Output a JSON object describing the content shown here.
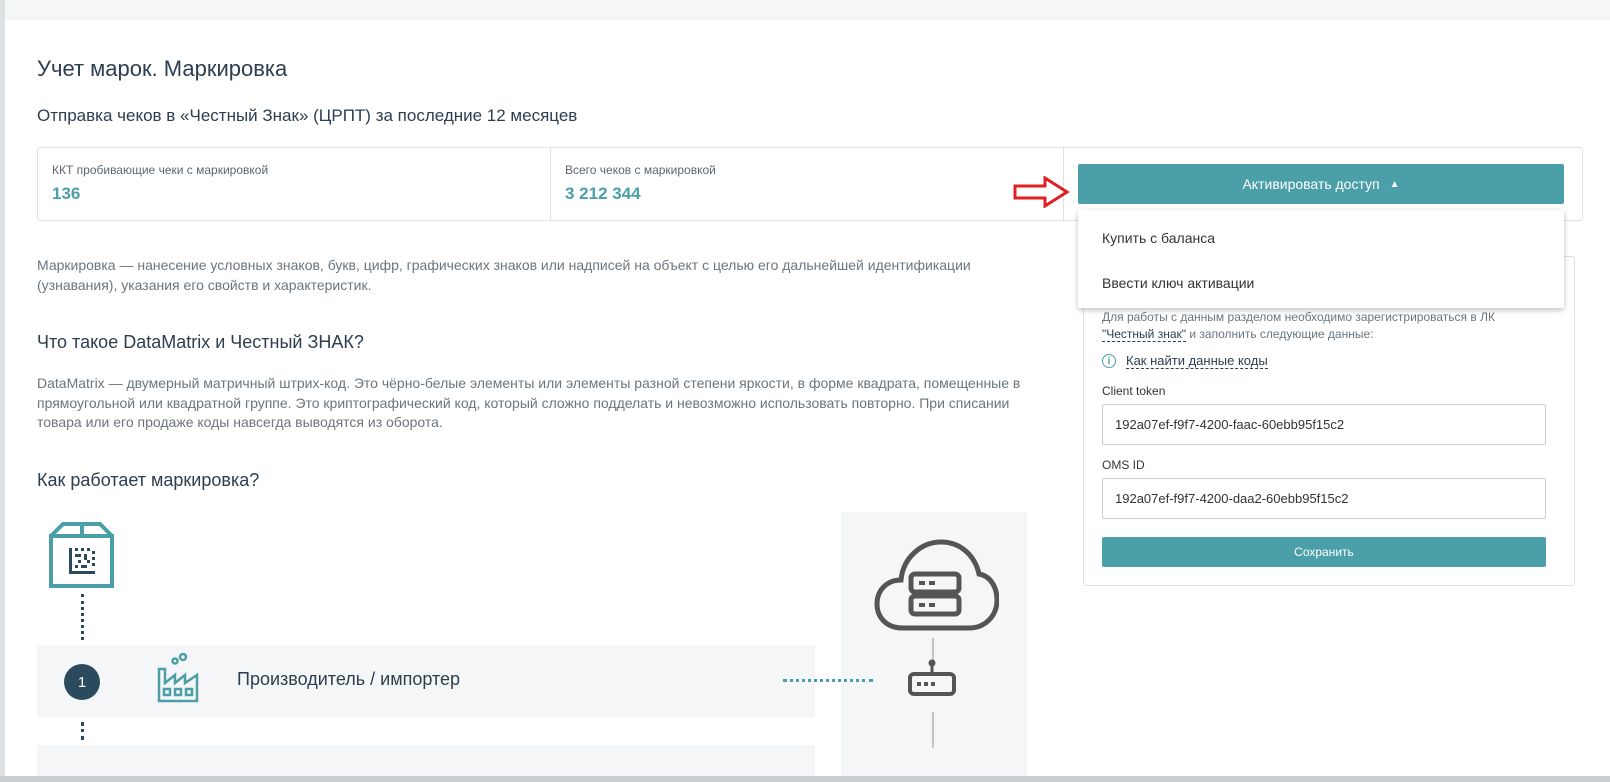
{
  "page": {
    "title": "Учет марок. Маркировка",
    "subtitle": "Отправка чеков в «Честный Знак» (ЦРПТ) за последние 12 месяцев"
  },
  "stats": [
    {
      "label": "ККТ пробивающие чеки с маркировкой",
      "value": "136"
    },
    {
      "label": "Всего чеков с маркировкой",
      "value": "3 212 344"
    }
  ],
  "activate": {
    "label": "Активировать доступ",
    "caret": "▲",
    "menu": [
      "Купить с баланса",
      "Ввести ключ активации"
    ]
  },
  "settings": {
    "description": "Для работы с данным разделом необходимо зарегистрироваться в ЛК",
    "lk_link": "\"Честный знак\"",
    "description_tail": "и заполнить следующие данные:",
    "info_link": "Как найти данные коды",
    "client_token_label": "Client token",
    "client_token_value": "192a07ef-f9f7-4200-faac-60ebb95f15c2",
    "oms_id_label": "OMS ID",
    "oms_id_value": "192a07ef-f9f7-4200-daa2-60ebb95f15c2",
    "save_label": "Сохранить"
  },
  "content": {
    "marking_text": "Маркировка — нанесение условных знаков, букв, цифр, графических знаков или надписей на объект с целью его дальнейшей идентификации (узнавания), указания его свойств и характеристик.",
    "datamatrix_heading": "Что такое DataMatrix и Честный ЗНАК?",
    "datamatrix_text": "DataMatrix — двумерный матричный штрих-код. Это чёрно-белые элементы или элементы разной степени яркости, в форме квадрата, помещенные в прямоугольной или квадратной группе. Это криптографический код, который сложно подделать и невозможно использовать повторно. При списании товара или его продаже коды навсегда выводятся из оборота.",
    "how_heading": "Как работает маркировка?"
  },
  "diagram": {
    "step_number": "1",
    "step_label": "Производитель / импортер"
  },
  "colors": {
    "accent": "#4a9fa8",
    "heading": "#2c3e4f",
    "badge": "#2c4a5e",
    "arrow": "#e02020"
  }
}
